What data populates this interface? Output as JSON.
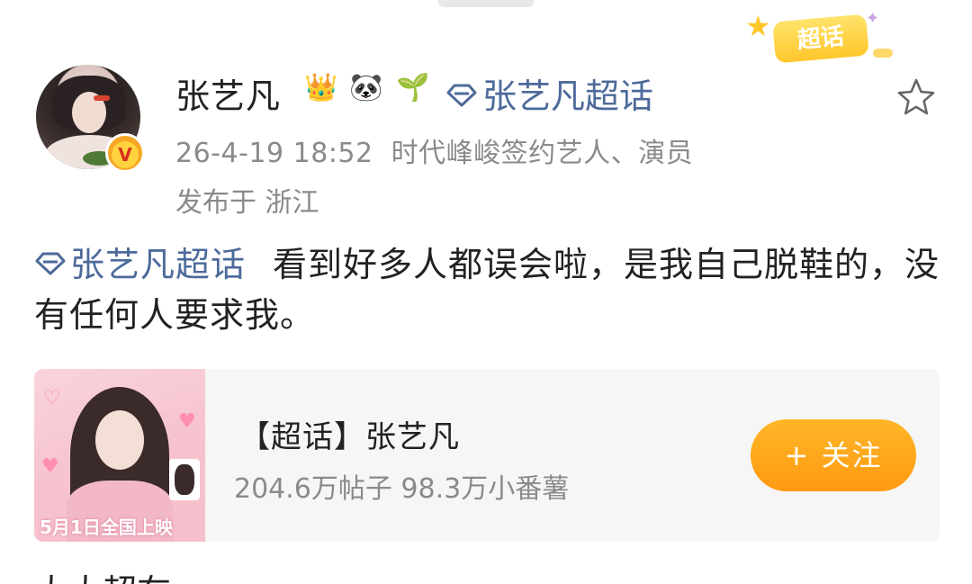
{
  "post": {
    "username": "张艺凡",
    "supertopic_link": "张艺凡超话",
    "timestamp": "26-4-19 18:52",
    "verified_title": "时代峰峻签约艺人、演员",
    "location": "发布于 浙江",
    "body_tag": "张艺凡超话",
    "body_text": "看到好多人都误会啦，是我自己脱鞋的，没有任何人要求我。",
    "badge_label": "超话"
  },
  "card": {
    "title": "【超话】张艺凡",
    "stats": "204.6万帖子 98.3万小番薯",
    "follow_label": "+ 关注",
    "poster_text": "5月1日全国上映"
  },
  "next": {
    "text": "大大超在"
  },
  "icons": {
    "badges": [
      "crown-icon",
      "panda-icon",
      "sprout-icon"
    ],
    "supertopic": "diamond-icon",
    "favorite": "star-icon"
  },
  "colors": {
    "link": "#4d6a9b",
    "follow": "#ff9a12",
    "meta": "#8a8a8a"
  }
}
